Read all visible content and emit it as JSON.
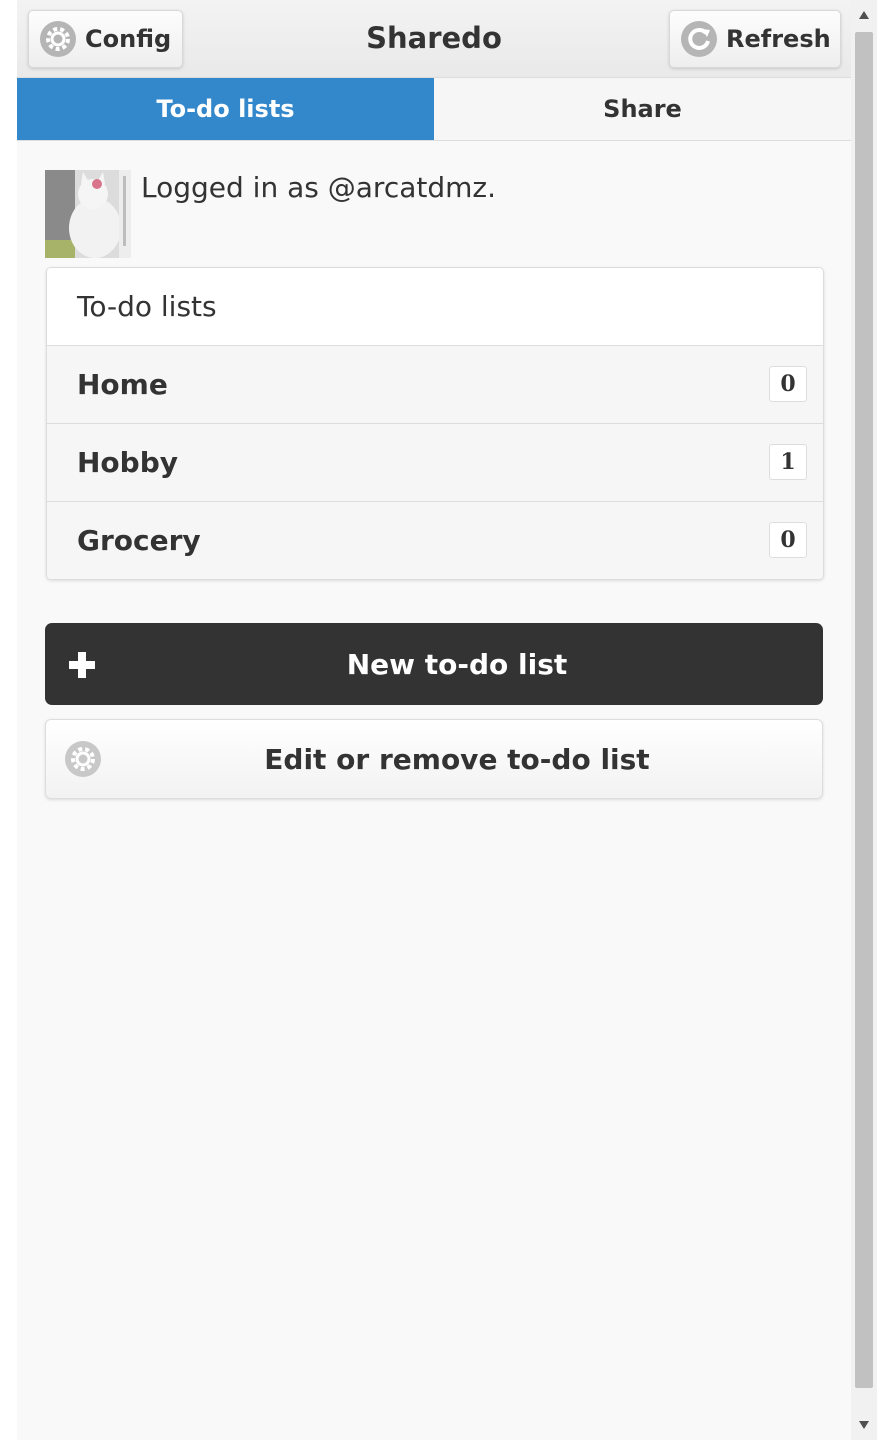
{
  "header": {
    "title": "Sharedo",
    "config_label": "Config",
    "refresh_label": "Refresh",
    "config_icon": "gear-icon",
    "refresh_icon": "refresh-icon"
  },
  "tabs": [
    {
      "label": "To-do lists",
      "active": true
    },
    {
      "label": "Share",
      "active": false
    }
  ],
  "login": {
    "text": "Logged in as @arcatdmz."
  },
  "todo_lists": {
    "header": "To-do lists",
    "items": [
      {
        "name": "Home",
        "count": "0"
      },
      {
        "name": "Hobby",
        "count": "1"
      },
      {
        "name": "Grocery",
        "count": "0"
      }
    ]
  },
  "actions": {
    "new_label": "New to-do list",
    "new_icon": "plus-icon",
    "edit_label": "Edit or remove to-do list",
    "edit_icon": "gear-icon"
  },
  "colors": {
    "accent": "#3388cc",
    "dark_button": "#333333",
    "background": "#f9f9f9"
  }
}
